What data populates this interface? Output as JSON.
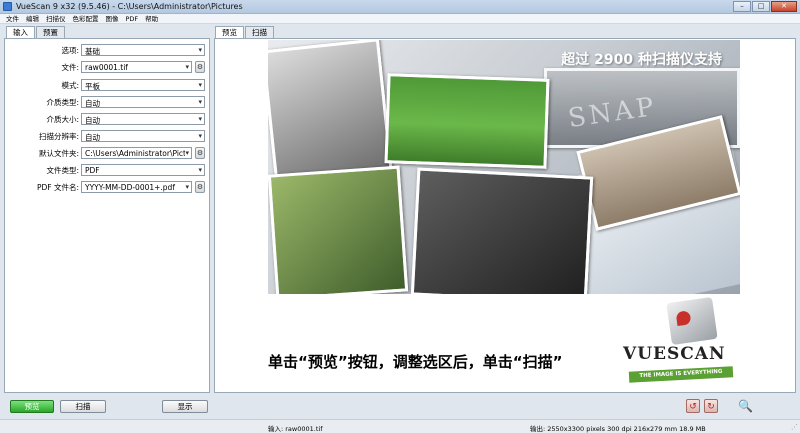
{
  "window": {
    "title": "VueScan 9 x32 (9.5.46) - C:\\Users\\Administrator\\Pictures",
    "controls": {
      "minimize": "–",
      "maximize": "□",
      "close": "✕"
    }
  },
  "menu": [
    "文件",
    "编辑",
    "扫描仪",
    "色彩配置",
    "图像",
    "PDF",
    "帮助"
  ],
  "left_tabs": [
    "输入",
    "预置"
  ],
  "settings": [
    {
      "label": "选项:",
      "value": "基础",
      "gear": false
    },
    {
      "label": "文件:",
      "value": "raw0001.tif",
      "gear": true
    },
    {
      "label": "模式:",
      "value": "平板",
      "gear": false
    },
    {
      "label": "介质类型:",
      "value": "自动",
      "gear": false
    },
    {
      "label": "介质大小:",
      "value": "自动",
      "gear": false
    },
    {
      "label": "扫描分辨率:",
      "value": "自动",
      "gear": false
    },
    {
      "label": "默认文件夹:",
      "value": "C:\\Users\\Administrator\\Pictu",
      "gear": true
    },
    {
      "label": "文件类型:",
      "value": "PDF",
      "gear": false
    },
    {
      "label": "PDF 文件名:",
      "value": "YYYY-MM-DD-0001+.pdf",
      "gear": true
    }
  ],
  "right_tabs": [
    "预览",
    "扫描"
  ],
  "preview": {
    "headline": "超过 2900 种扫描仪支持",
    "snap_text": "SNAP",
    "banner": "单击“预览”按钮，调整选区后，单击“扫描”",
    "logo_text": "VUESCAN",
    "slogan": "THE IMAGE IS EVERYTHING"
  },
  "buttons": {
    "preview": "预览",
    "scan": "扫描",
    "show": "显示"
  },
  "status": {
    "input": "输入: raw0001.tif",
    "output": "输出: 2550x3300 pixels 300 dpi 216x279 mm 18.9 MB"
  },
  "colors": {
    "accent_green": "#29a829",
    "title_bar": "#b3c8e0"
  },
  "icons": {
    "gear": "⚙",
    "dropdown": "▾",
    "rotate_left": "↺",
    "rotate_right": "↻",
    "zoom": "🔍",
    "grip": "⋰"
  }
}
